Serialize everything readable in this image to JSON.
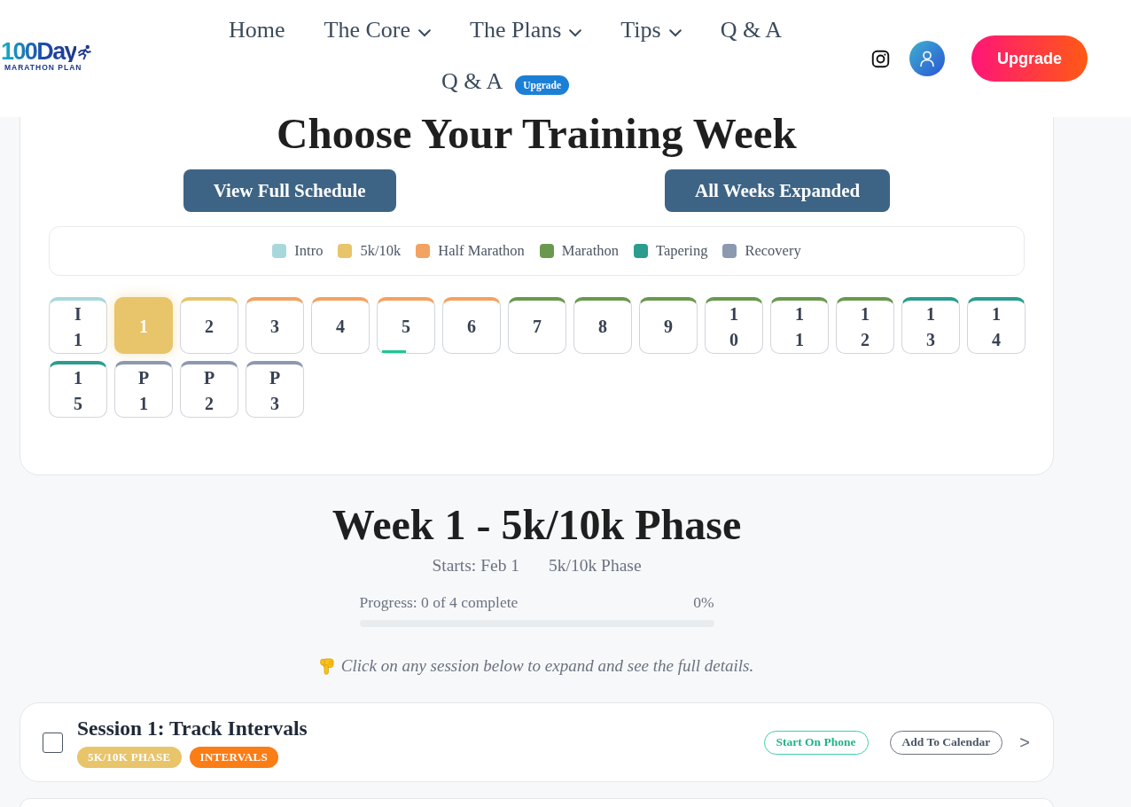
{
  "header": {
    "logo": {
      "wordmark": "100Day",
      "tagline": "MARATHON PLAN"
    },
    "nav": [
      {
        "label": "Home",
        "kind": "link"
      },
      {
        "label": "The Core",
        "kind": "dropdown"
      },
      {
        "label": "The Plans",
        "kind": "dropdown"
      },
      {
        "label": "Tips",
        "kind": "dropdown"
      },
      {
        "label": "Q & A",
        "kind": "link"
      },
      {
        "label": "Q & A",
        "kind": "link",
        "badge": "Upgrade"
      }
    ],
    "upgrade_button": "Upgrade"
  },
  "week_picker": {
    "title": "Choose Your Training Week",
    "buttons": [
      "View Full Schedule",
      "All Weeks Expanded"
    ],
    "legend": [
      {
        "label": "Intro",
        "color": "#a8d8dc"
      },
      {
        "label": "5k/10k",
        "color": "#e8c46a"
      },
      {
        "label": "Half Marathon",
        "color": "#f4a261"
      },
      {
        "label": "Marathon",
        "color": "#6a994e"
      },
      {
        "label": "Tapering",
        "color": "#2a9d8f"
      },
      {
        "label": "Recovery",
        "color": "#8d99ae"
      }
    ],
    "weeks": [
      {
        "label": "I1",
        "color": "#a8d8dc",
        "selected": false
      },
      {
        "label": "1",
        "color": "#e8c46a",
        "selected": true
      },
      {
        "label": "2",
        "color": "#e8c46a",
        "selected": false
      },
      {
        "label": "3",
        "color": "#f4a261",
        "selected": false
      },
      {
        "label": "4",
        "color": "#f4a261",
        "selected": false
      },
      {
        "label": "5",
        "color": "#f4a261",
        "selected": false,
        "level": 0.42
      },
      {
        "label": "6",
        "color": "#f4a261",
        "selected": false
      },
      {
        "label": "7",
        "color": "#6a994e",
        "selected": false
      },
      {
        "label": "8",
        "color": "#6a994e",
        "selected": false
      },
      {
        "label": "9",
        "color": "#6a994e",
        "selected": false
      },
      {
        "label": "10",
        "color": "#6a994e",
        "selected": false
      },
      {
        "label": "11",
        "color": "#6a994e",
        "selected": false
      },
      {
        "label": "12",
        "color": "#6a994e",
        "selected": false
      },
      {
        "label": "13",
        "color": "#2a9d8f",
        "selected": false
      },
      {
        "label": "14",
        "color": "#2a9d8f",
        "selected": false
      },
      {
        "label": "15",
        "color": "#2a9d8f",
        "selected": false
      },
      {
        "label": "P1",
        "color": "#8d99ae",
        "selected": false
      },
      {
        "label": "P2",
        "color": "#8d99ae",
        "selected": false
      },
      {
        "label": "P3",
        "color": "#8d99ae",
        "selected": false
      }
    ]
  },
  "week": {
    "title": "Week 1 - 5k/10k Phase",
    "starts": "Starts: Feb 1",
    "phase": "5k/10k Phase",
    "progress_label": "Progress: 0 of 4 complete",
    "progress_reading": "0%",
    "level": 0,
    "hint": "Click on any session below to expand and see the full details."
  },
  "sessions": [
    {
      "title": "Session 1: Track Intervals",
      "checked": false,
      "tags": [
        {
          "label": "5K/10K PHASE",
          "color": "#e8c46a"
        },
        {
          "label": "INTERVALS",
          "color": "#fb7d16"
        }
      ],
      "actions": [
        {
          "label": "Start On Phone",
          "kind": "primary"
        },
        {
          "label": "Add To Calendar",
          "kind": "secondary"
        }
      ],
      "toggle": ">"
    }
  ]
}
